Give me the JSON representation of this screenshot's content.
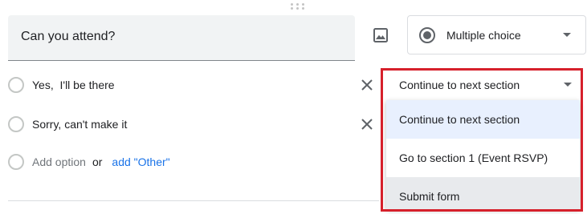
{
  "question": {
    "title": "Can you attend?",
    "type_label": "Multiple choice"
  },
  "options": [
    {
      "label": "Yes,  I'll be there"
    },
    {
      "label": "Sorry, can't make it"
    }
  ],
  "add_option": {
    "label": "Add option",
    "or_text": "or",
    "other_link": "add \"Other\""
  },
  "section_select": {
    "selected": "Continue to next section"
  },
  "menu": {
    "items": [
      {
        "label": "Continue to next section"
      },
      {
        "label": "Go to section 1 (Event RSVP)"
      },
      {
        "label": "Submit form"
      }
    ]
  },
  "colors": {
    "highlight": "#d6202b",
    "link": "#1a73e8",
    "selected_bg": "#e8f0fe"
  }
}
